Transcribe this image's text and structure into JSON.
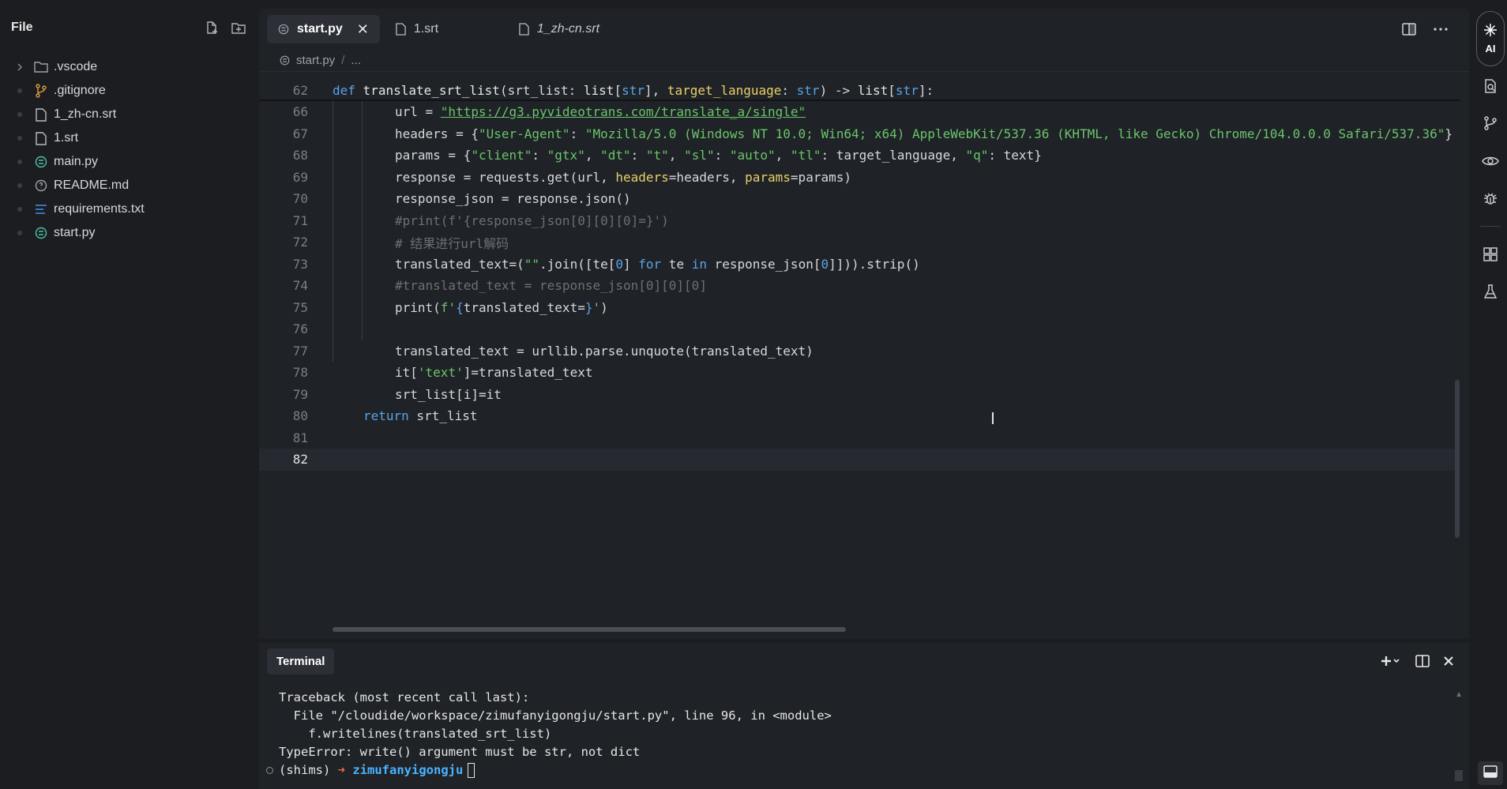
{
  "explorer": {
    "title": "File",
    "items": [
      {
        "label": ".vscode",
        "type": "folder"
      },
      {
        "label": ".gitignore",
        "type": "git"
      },
      {
        "label": "1_zh-cn.srt",
        "type": "file"
      },
      {
        "label": "1.srt",
        "type": "file"
      },
      {
        "label": "main.py",
        "type": "python"
      },
      {
        "label": "README.md",
        "type": "readme"
      },
      {
        "label": "requirements.txt",
        "type": "text"
      },
      {
        "label": "start.py",
        "type": "python"
      }
    ]
  },
  "tabs": [
    {
      "label": "start.py",
      "active": true
    },
    {
      "label": "1.srt",
      "active": false
    },
    {
      "label": "1_zh-cn.srt",
      "active": false
    }
  ],
  "tab_close_glyph": "✕",
  "breadcrumb": {
    "file": "start.py",
    "sep": "/",
    "rest": "..."
  },
  "code": {
    "sticky_line": {
      "num": "62",
      "text": "def translate_srt_list(srt_list: list[str], target_language: str) -> list[str]:"
    },
    "lines": [
      {
        "num": "66"
      },
      {
        "num": "67"
      },
      {
        "num": "68"
      },
      {
        "num": "69"
      },
      {
        "num": "70"
      },
      {
        "num": "71"
      },
      {
        "num": "72"
      },
      {
        "num": "73"
      },
      {
        "num": "74"
      },
      {
        "num": "75"
      },
      {
        "num": "76"
      },
      {
        "num": "77"
      },
      {
        "num": "78"
      },
      {
        "num": "79"
      },
      {
        "num": "80"
      },
      {
        "num": "81"
      },
      {
        "num": "82"
      }
    ],
    "line66": {
      "pre": "url = ",
      "url": "\"https://g3.pyvideotrans.com/translate_a/single\""
    },
    "line67": {
      "pre": "headers = {",
      "s1": "\"User-Agent\"",
      "mid": ": ",
      "s2": "\"Mozilla/5.0 (Windows NT 10.0; Win64; x64) AppleWebKit/537.36 (KHTML, like Gecko) Chrome/104.0.0.0 Safari/537.36\"",
      "post": "}"
    },
    "line68": {
      "pre": "params = {",
      "a": "\"client\"",
      "b": ": ",
      "c": "\"gtx\"",
      "d": ", ",
      "e": "\"dt\"",
      "f": ": ",
      "g": "\"t\"",
      "h": ", ",
      "i": "\"sl\"",
      "j": ": ",
      "k": "\"auto\"",
      "l": ", ",
      "m": "\"tl\"",
      "n": ": target_language, ",
      "o": "\"q\"",
      "p": ": text}"
    },
    "line69": {
      "pre": "response = requests.get(url, ",
      "k1": "headers",
      "m1": "=headers, ",
      "k2": "params",
      "m2": "=params)"
    },
    "line70": {
      "text": "response_json = response.json()"
    },
    "line71": {
      "text": "#print(f'{response_json[0][0][0]=}')"
    },
    "line72": {
      "text": "# 结果进行url解码"
    },
    "line73": {
      "pre": "translated_text=(",
      "s": "\"\"",
      "a": ".join([te[",
      "n0": "0",
      "b": "] ",
      "kf": "for",
      "c": " te ",
      "ki": "in",
      "d": " response_json[",
      "n1": "0",
      "e": "]])).strip()"
    },
    "line74": {
      "text": "#translated_text = response_json[0][0][0]"
    },
    "line75": {
      "pre": "print(",
      "s1": "f'",
      "br1": "{",
      "mid": "translated_text=",
      "br2": "}",
      "s2": "'",
      "post": ")"
    },
    "line77": {
      "text": "translated_text = urllib.parse.unquote(translated_text)"
    },
    "line78": {
      "pre": "it[",
      "s": "'text'",
      "post": "]=translated_text"
    },
    "line79": {
      "text": "srt_list[i]=it"
    },
    "line80": {
      "kw": "return",
      "post": " srt_list"
    }
  },
  "terminal": {
    "tab_label": "Terminal",
    "lines": [
      "Traceback (most recent call last):",
      "  File \"/cloudide/workspace/zimufanyigongju/start.py\", line 96, in <module>",
      "    f.writelines(translated_srt_list)",
      "TypeError: write() argument must be str, not dict"
    ],
    "prompt": {
      "env": "(shims)",
      "arrow": "➜",
      "dir": "zimufanyigongju"
    }
  },
  "activity": {
    "ai_label": "AI"
  },
  "colors": {
    "accent": "#5aa3e8",
    "string": "#6bc46d",
    "param": "#e8d06a",
    "comment": "#6c7076",
    "prompt_arrow": "#e0753a",
    "prompt_dir": "#4ab3ff"
  },
  "icons": [
    "new-file-icon",
    "new-folder-icon",
    "split-editor-icon",
    "more-icon",
    "add-terminal-icon",
    "split-terminal-icon",
    "close-panel-icon",
    "ai-sparkle-icon",
    "search-doc-icon",
    "source-control-icon",
    "preview-icon",
    "debug-icon",
    "extensions-icon",
    "test-flask-icon",
    "panel-toggle-icon"
  ]
}
